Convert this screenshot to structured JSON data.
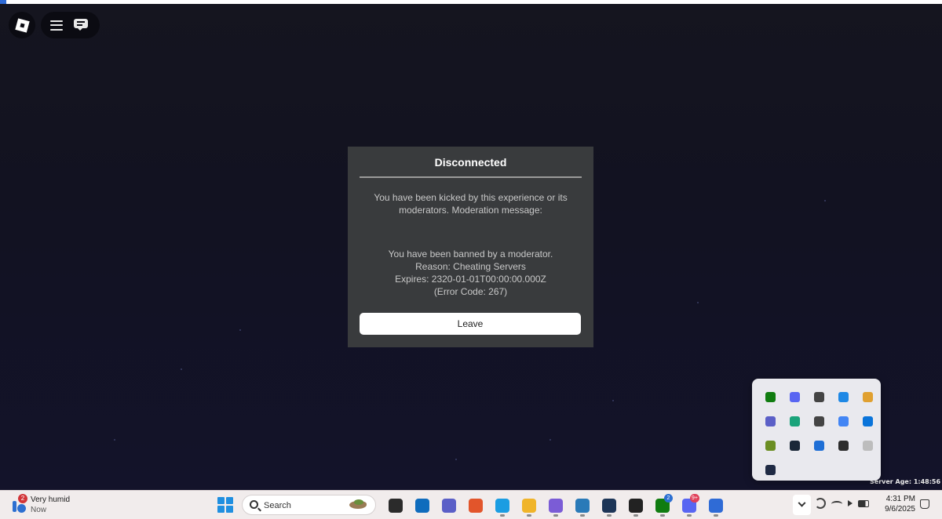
{
  "hud": {
    "roblox_menu_icon": "roblox-logo-icon",
    "hamburger_icon": "hamburger-icon",
    "chat_icon": "chat-icon"
  },
  "dialog": {
    "title": "Disconnected",
    "message_line1": "You have been kicked by this experience or its",
    "message_line2": "moderators. Moderation message:",
    "reason_line1": "You have been banned by a moderator.",
    "reason_line2": "Reason: Cheating Servers",
    "reason_line3": "Expires: 2320-01-01T00:00:00.000Z",
    "reason_line4": "(Error Code: 267)",
    "leave_label": "Leave"
  },
  "server_age": "Server Age: 1:48:56",
  "tray_flyout": {
    "icons": [
      {
        "name": "xbox-icon",
        "color": "#107c10"
      },
      {
        "name": "discord-tray-icon",
        "color": "#5865f2"
      },
      {
        "name": "pin-icon",
        "color": "#444444"
      },
      {
        "name": "edge-icon",
        "color": "#1e88e5"
      },
      {
        "name": "glasses-icon",
        "color": "#e0a030"
      },
      {
        "name": "teams-icon",
        "color": "#5b5fc7"
      },
      {
        "name": "greenchat-icon",
        "color": "#1aa37a"
      },
      {
        "name": "cloud-off-icon",
        "color": "#444444"
      },
      {
        "name": "google-icon",
        "color": "#4285f4"
      },
      {
        "name": "bluetooth-icon",
        "color": "#0a74da"
      },
      {
        "name": "minecraft-icon",
        "color": "#6b8e23"
      },
      {
        "name": "steam-icon",
        "color": "#1b2838"
      },
      {
        "name": "defender-icon",
        "color": "#1f6fd6"
      },
      {
        "name": "nvidia-icon",
        "color": "#2d2d2d"
      },
      {
        "name": "display-icon",
        "color": "#bdbdbd"
      },
      {
        "name": "media-icon",
        "color": "#1f2a44"
      }
    ]
  },
  "taskbar": {
    "weather_title": "Very humid",
    "weather_sub": "Now",
    "weather_badge": "2",
    "search_placeholder": "Search",
    "apps": [
      {
        "name": "taskview-app",
        "color": "#2b2b2b",
        "badge": ""
      },
      {
        "name": "outlook-app",
        "color": "#0f6cbd",
        "badge": ""
      },
      {
        "name": "teams-app",
        "color": "#5b5fc7",
        "badge": ""
      },
      {
        "name": "firefox-app",
        "color": "#e2552b",
        "badge": ""
      },
      {
        "name": "edge-app",
        "color": "#1b9de2",
        "badge": ""
      },
      {
        "name": "file-explorer-app",
        "color": "#f0b429",
        "badge": ""
      },
      {
        "name": "copilot-app",
        "color": "#7b5cd6",
        "badge": ""
      },
      {
        "name": "store-app",
        "color": "#2a7ab8",
        "badge": ""
      },
      {
        "name": "widget-app",
        "color": "#1d3557",
        "badge": ""
      },
      {
        "name": "manager-app",
        "color": "#222222",
        "badge": ""
      },
      {
        "name": "xbox-app",
        "color": "#107c10",
        "badge": "2"
      },
      {
        "name": "discord-app",
        "color": "#5865f2",
        "badge": "9+"
      },
      {
        "name": "roblox-app",
        "color": "#2f6bd6",
        "badge": ""
      }
    ],
    "time": "4:31 PM",
    "date": "9/6/2025"
  }
}
